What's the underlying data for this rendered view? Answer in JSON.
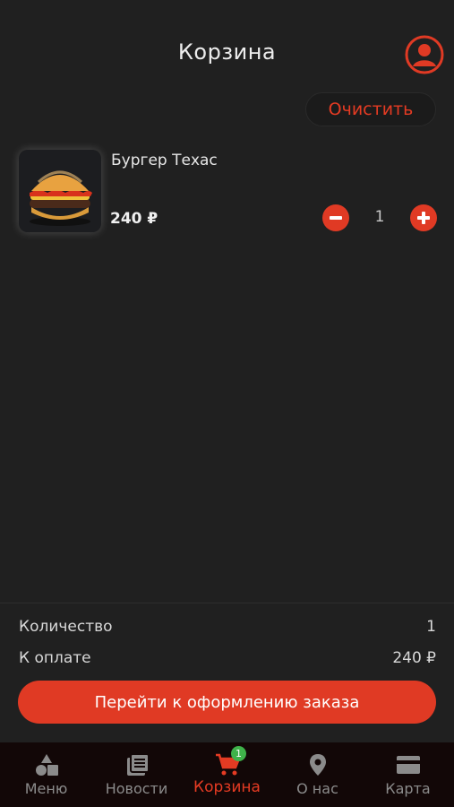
{
  "header": {
    "title": "Корзина",
    "profile_icon": "user-circle-icon"
  },
  "actions": {
    "clear_label": "Очистить"
  },
  "cart": {
    "items": [
      {
        "name": "Бургер Техас",
        "price": "240 ₽",
        "quantity": "1",
        "image": "burger-photo"
      }
    ]
  },
  "summary": {
    "quantity_label": "Количество",
    "quantity_value": "1",
    "total_label": "К оплате",
    "total_value": "240 ₽",
    "checkout_label": "Перейти к оформлению заказа"
  },
  "nav": {
    "items": [
      {
        "label": "Меню",
        "icon": "shapes-icon"
      },
      {
        "label": "Новости",
        "icon": "news-icon"
      },
      {
        "label": "Корзина",
        "icon": "cart-icon",
        "badge": "1",
        "active": true
      },
      {
        "label": "О нас",
        "icon": "location-pin-icon"
      },
      {
        "label": "Карта",
        "icon": "credit-card-icon"
      }
    ]
  },
  "colors": {
    "accent": "#e03a24",
    "background": "#202020",
    "nav_background": "#120707",
    "badge": "#3fb24a"
  }
}
